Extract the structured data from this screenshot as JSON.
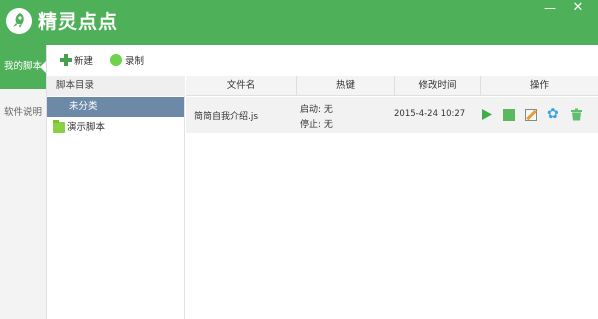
{
  "app": {
    "title": "精灵点点"
  },
  "window": {
    "minimize": "—",
    "close": "✕"
  },
  "nav": {
    "items": [
      {
        "label": "我的脚本",
        "active": true
      },
      {
        "label": "软件说明",
        "active": false
      }
    ]
  },
  "toolbar": {
    "new_label": "新建",
    "record_label": "录制"
  },
  "tree": {
    "header": "脚本目录",
    "items": [
      {
        "label": "未分类",
        "selected": true
      },
      {
        "label": "演示脚本",
        "selected": false
      }
    ]
  },
  "table": {
    "columns": [
      "文件名",
      "热键",
      "修改时间",
      "操作"
    ],
    "rows": [
      {
        "filename": "简简自我介绍.js",
        "hotkey_start": "启动: 无",
        "hotkey_stop": "停止: 无",
        "modified": "2015-4-24 10:27",
        "ops": [
          "play-icon",
          "stop-icon",
          "edit-icon",
          "gear-icon",
          "trash-icon"
        ]
      }
    ]
  },
  "colors": {
    "brand": "#4fb05a",
    "selected_row": "#6d89a8",
    "accent_blue": "#3aa3e3"
  }
}
